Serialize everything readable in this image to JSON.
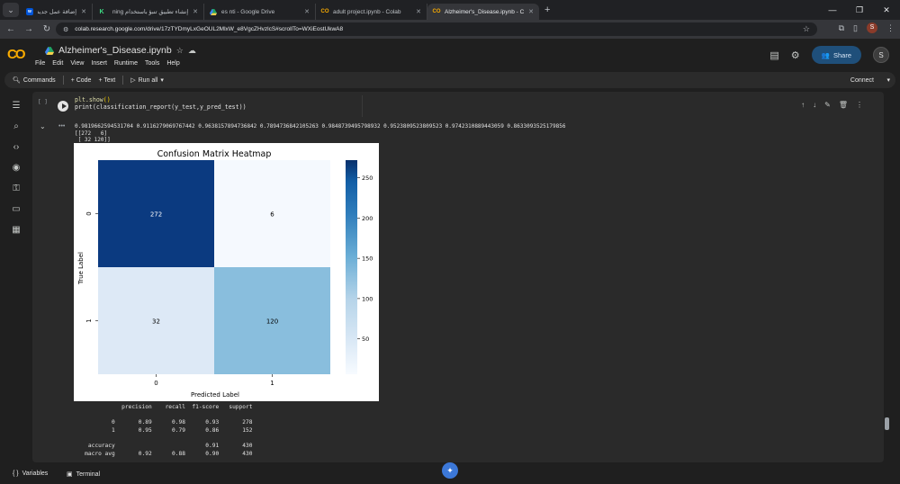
{
  "browser": {
    "tabs": [
      {
        "title": "إضافة عمل جديد | إشغلني",
        "favicon": "wuzzuf",
        "active": false
      },
      {
        "title": "إنشاء تطبيق تنبؤ باستخدام ning",
        "favicon": "k-logo",
        "active": false
      },
      {
        "title": "es nti - Google Drive",
        "favicon": "drive",
        "active": false
      },
      {
        "title": "adult project.ipynb - Colab",
        "favicon": "colab",
        "active": false
      },
      {
        "title": "Alzheimer's_Disease.ipynb - Co",
        "favicon": "colab",
        "active": true
      }
    ],
    "new_tab_label": "+",
    "url": "colab.research.google.com/drive/17zTYDmyLxGeOUL2MlxW_e8VgcZHvzlcS#scrollTo=WXiEostUkwA8",
    "profile_initial": "S"
  },
  "colab": {
    "notebook_title": "Alzheimer's_Disease.ipynb",
    "menu": [
      "File",
      "Edit",
      "View",
      "Insert",
      "Runtime",
      "Tools",
      "Help"
    ],
    "share_label": "Share",
    "avatar_initial": "S",
    "toolbar": {
      "commands": "Commands",
      "code": "+ Code",
      "text": "+ Text",
      "run_all": "Run all",
      "connect": "Connect"
    }
  },
  "cell": {
    "bracket": "[ ]",
    "code_line1_fn": "plt.show",
    "code_line1_tail": "()",
    "code_line2": "print(classification_report(y_test,y_pred_test))",
    "output_lines": [
      "0.9819662594531704 0.9116279069767442 0.9638157894736842 0.7894736842105263 0.9848739495798932 0.9523809523809523 0.9742310889443059 0.8633093525179856",
      "[[272   6]",
      " [ 32 120]]"
    ],
    "report_lines": [
      "              precision    recall  f1-score   support",
      "",
      "           0       0.89      0.98      0.93       278",
      "           1       0.95      0.79      0.86       152",
      "",
      "    accuracy                           0.91       430",
      "   macro avg       0.92      0.88      0.90       430"
    ]
  },
  "chart_data": {
    "type": "heatmap",
    "title": "Confusion Matrix Heatmap",
    "xlabel": "Predicted Label",
    "ylabel": "True Label",
    "x_categories": [
      "0",
      "1"
    ],
    "y_categories": [
      "0",
      "1"
    ],
    "values": [
      [
        272,
        6
      ],
      [
        32,
        120
      ]
    ],
    "colormap": "Blues",
    "colorbar_ticks": [
      50,
      100,
      150,
      200,
      250
    ],
    "colorbar_range": [
      6,
      272
    ],
    "colors": {
      "272": "#0b3a80",
      "6": "#f5f9fe",
      "32": "#dde9f6",
      "120": "#89bedd"
    }
  },
  "statusbar": {
    "variables": "Variables",
    "terminal": "Terminal"
  }
}
